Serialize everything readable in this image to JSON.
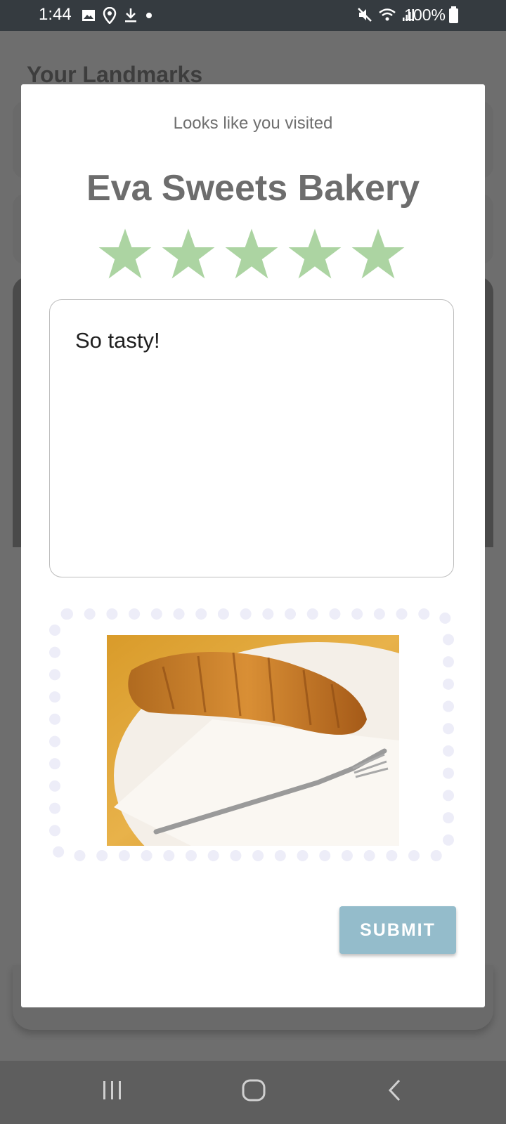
{
  "status_bar": {
    "time": "1:44",
    "left_icons": [
      "image-icon",
      "location-icon",
      "download-icon",
      "dot-icon"
    ],
    "right_icons": [
      "mute-icon",
      "wifi-icon",
      "signal-icon"
    ],
    "battery": "100%"
  },
  "background": {
    "title": "Your Landmarks"
  },
  "modal": {
    "subtitle": "Looks like you visited",
    "place_name": "Eva Sweets Bakery",
    "rating": 5,
    "rating_max": 5,
    "star_color": "#acd4a2",
    "review_text": "So tasty!",
    "photo_alt": "croissant-photo",
    "submit_label": "SUBMIT",
    "submit_color": "#94bccb"
  },
  "system_nav": [
    "recents-icon",
    "home-icon",
    "back-icon"
  ]
}
